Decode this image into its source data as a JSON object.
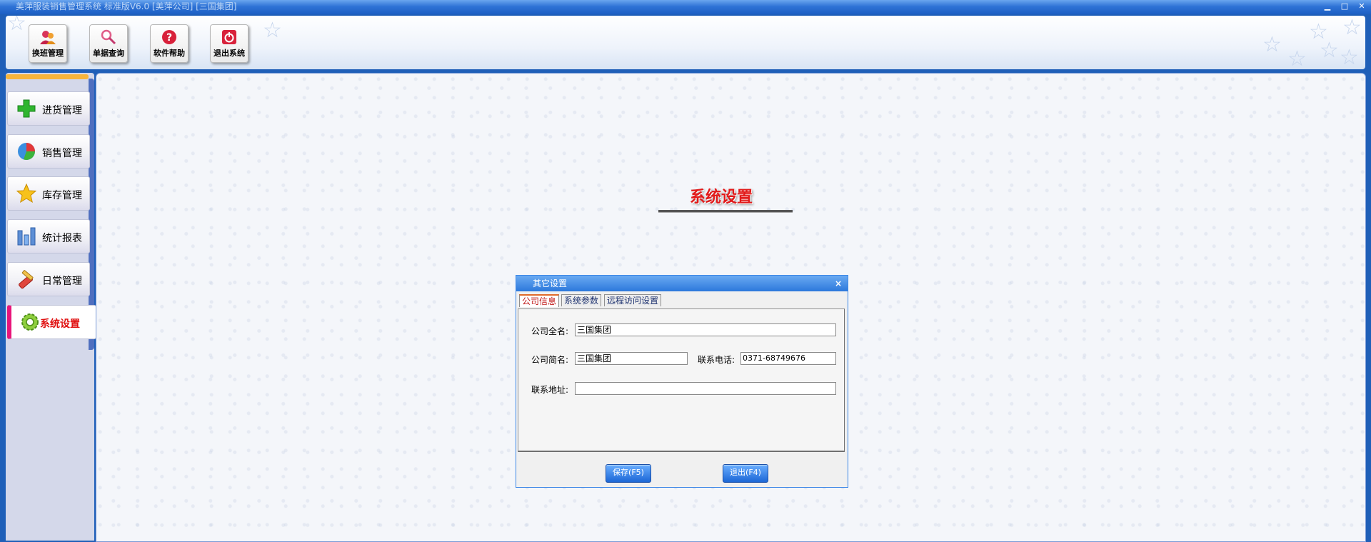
{
  "window": {
    "title": "美萍服装销售管理系统 标准版V6.0 [美萍公司] [三国集团]",
    "minimize_glyph": "▁",
    "maximize_glyph": "□",
    "close_glyph": "✕"
  },
  "toolbar": {
    "buttons": [
      {
        "label": "换班管理",
        "icon": "users-icon"
      },
      {
        "label": "单据查询",
        "icon": "search-icon"
      },
      {
        "label": "软件帮助",
        "icon": "help-icon"
      },
      {
        "label": "退出系统",
        "icon": "power-icon"
      }
    ]
  },
  "sidebar": {
    "items": [
      {
        "label": "进货管理",
        "icon": "green-plus-icon"
      },
      {
        "label": "销售管理",
        "icon": "pie-chart-icon"
      },
      {
        "label": "库存管理",
        "icon": "star-icon"
      },
      {
        "label": "统计报表",
        "icon": "bar-chart-icon"
      },
      {
        "label": "日常管理",
        "icon": "tools-icon"
      },
      {
        "label": "系统设置",
        "icon": "gear-icon",
        "active": true
      }
    ]
  },
  "main": {
    "page_title": "系统设置"
  },
  "dialog": {
    "title": "其它设置",
    "close_glyph": "×",
    "tabs": [
      {
        "label": "公司信息",
        "active": true
      },
      {
        "label": "系统参数",
        "active": false
      },
      {
        "label": "远程访问设置",
        "active": false
      }
    ],
    "fields": {
      "company_full_name_label": "公司全名:",
      "company_full_name_value": "三国集团",
      "company_short_name_label": "公司简名:",
      "company_short_name_value": "三国集团",
      "phone_label": "联系电话:",
      "phone_value": "0371-68749676",
      "address_label": "联系地址:",
      "address_value": ""
    },
    "buttons": {
      "save": "保存(F5)",
      "exit": "退出(F4)"
    }
  },
  "colors": {
    "accent_blue": "#2c78dc",
    "title_red": "#e21a1a",
    "active_nav_bar": "#e8157a"
  }
}
